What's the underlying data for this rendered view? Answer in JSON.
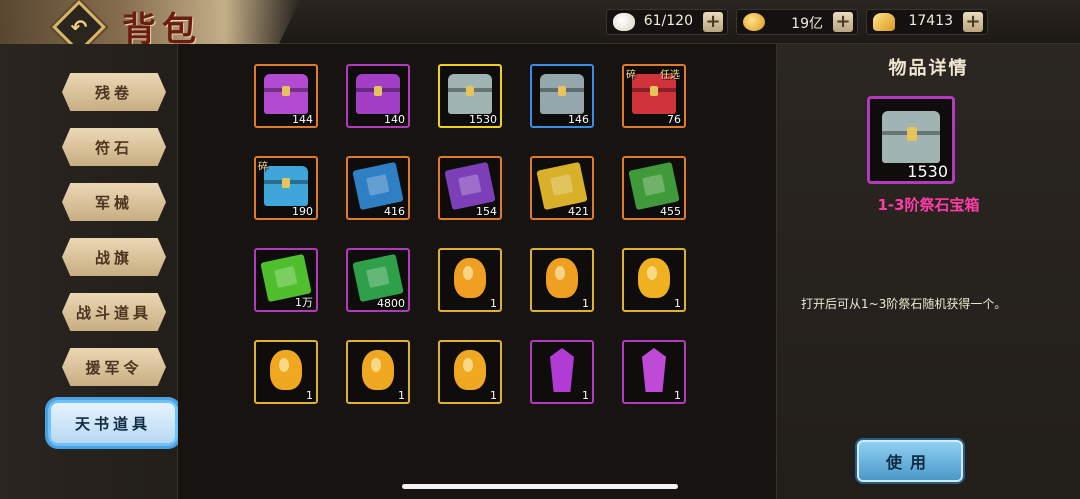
{
  "header": {
    "title": "背包",
    "back_icon": "back-arrow-icon"
  },
  "currencies": [
    {
      "name": "food",
      "icon": "bun-icon",
      "value": "61/120"
    },
    {
      "name": "coin",
      "icon": "coin-icon",
      "value": "19亿"
    },
    {
      "name": "gold",
      "icon": "gold-ingot-icon",
      "value": "17413"
    }
  ],
  "sidebar": {
    "tabs": [
      {
        "label": "残卷"
      },
      {
        "label": "符石"
      },
      {
        "label": "军械"
      },
      {
        "label": "战旗"
      },
      {
        "label": "战斗道具"
      },
      {
        "label": "援军令"
      },
      {
        "label": "天书道具",
        "active": true
      }
    ]
  },
  "grid": {
    "items": [
      {
        "count": "144",
        "kind": "chest",
        "color": "#b34ad2",
        "border": "#e07a2c"
      },
      {
        "count": "140",
        "kind": "chest",
        "color": "#a23fc6",
        "border": "#b23bbd"
      },
      {
        "count": "1530",
        "kind": "chest",
        "color": "#9fb4b3",
        "border": "#f0d21c"
      },
      {
        "count": "146",
        "kind": "chest",
        "color": "#93a8ad",
        "border": "#3a8ee6"
      },
      {
        "count": "76",
        "kind": "chest",
        "color": "#d0343a",
        "border": "#e07a2c",
        "tag": "碎",
        "tag2": "任选"
      },
      {
        "count": "190",
        "kind": "chest",
        "color": "#3fa6d9",
        "border": "#e07a2c",
        "tag": "碎"
      },
      {
        "count": "416",
        "kind": "book",
        "color": "#2f7fc4",
        "border": "#e07a2c"
      },
      {
        "count": "154",
        "kind": "book",
        "color": "#7d3fb8",
        "border": "#e07a2c"
      },
      {
        "count": "421",
        "kind": "book",
        "color": "#d8b02a",
        "border": "#e07a2c"
      },
      {
        "count": "455",
        "kind": "book",
        "color": "#3f9a3a",
        "border": "#e07a2c"
      },
      {
        "count": "1万",
        "kind": "book",
        "color": "#4fbf2e",
        "border": "#b23bbd"
      },
      {
        "count": "4800",
        "kind": "book",
        "color": "#2fa04a",
        "border": "#b23bbd"
      },
      {
        "count": "1",
        "kind": "gem",
        "color": "#f0a020",
        "border": "#e0b030"
      },
      {
        "count": "1",
        "kind": "gem",
        "color": "#f0a020",
        "border": "#e0b030"
      },
      {
        "count": "1",
        "kind": "gem",
        "color": "#f0b020",
        "border": "#e0b030"
      },
      {
        "count": "1",
        "kind": "gem",
        "color": "#f0a820",
        "border": "#e0b030"
      },
      {
        "count": "1",
        "kind": "gem",
        "color": "#f0a820",
        "border": "#e0b030"
      },
      {
        "count": "1",
        "kind": "gem",
        "color": "#f0a820",
        "border": "#e0b030"
      },
      {
        "count": "1",
        "kind": "crystal",
        "color": "#b23bd6",
        "border": "#b23bbd"
      },
      {
        "count": "1",
        "kind": "crystal",
        "color": "#c04ad8",
        "border": "#b23bbd"
      }
    ]
  },
  "detail": {
    "title": "物品详情",
    "count": "1530",
    "name": "1-3阶祭石宝箱",
    "description": "打开后可从1~3阶祭石随机获得一个。",
    "use_label": "使用",
    "icon_color": "#9fb4b3"
  }
}
